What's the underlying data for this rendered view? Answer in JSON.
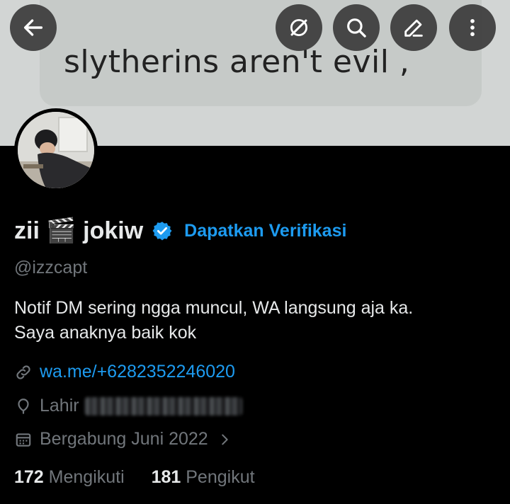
{
  "banner": {
    "text": "slytherins aren't evil ,"
  },
  "toolbar": {
    "back_icon": "back-arrow-icon",
    "grok_icon": "grok-icon",
    "search_icon": "search-icon",
    "edit_icon": "edit-icon",
    "more_icon": "more-vert-icon"
  },
  "profile": {
    "name": "zii 🎬 jokiw",
    "get_verified": "Dapatkan Verifikasi",
    "handle": "@izzcapt",
    "bio_line1": "Notif DM sering ngga muncul, WA langsung aja ka.",
    "bio_line2": "Saya anaknya baik kok",
    "link": "wa.me/+6282352246020",
    "birth_label": "Lahir",
    "joined": "Bergabung Juni 2022",
    "following_count": "172",
    "following_label": "Mengikuti",
    "followers_count": "181",
    "followers_label": "Pengikut"
  },
  "colors": {
    "accent": "#1d9bf0",
    "muted": "#71767b",
    "text": "#e7e9ea",
    "background": "#000000"
  }
}
